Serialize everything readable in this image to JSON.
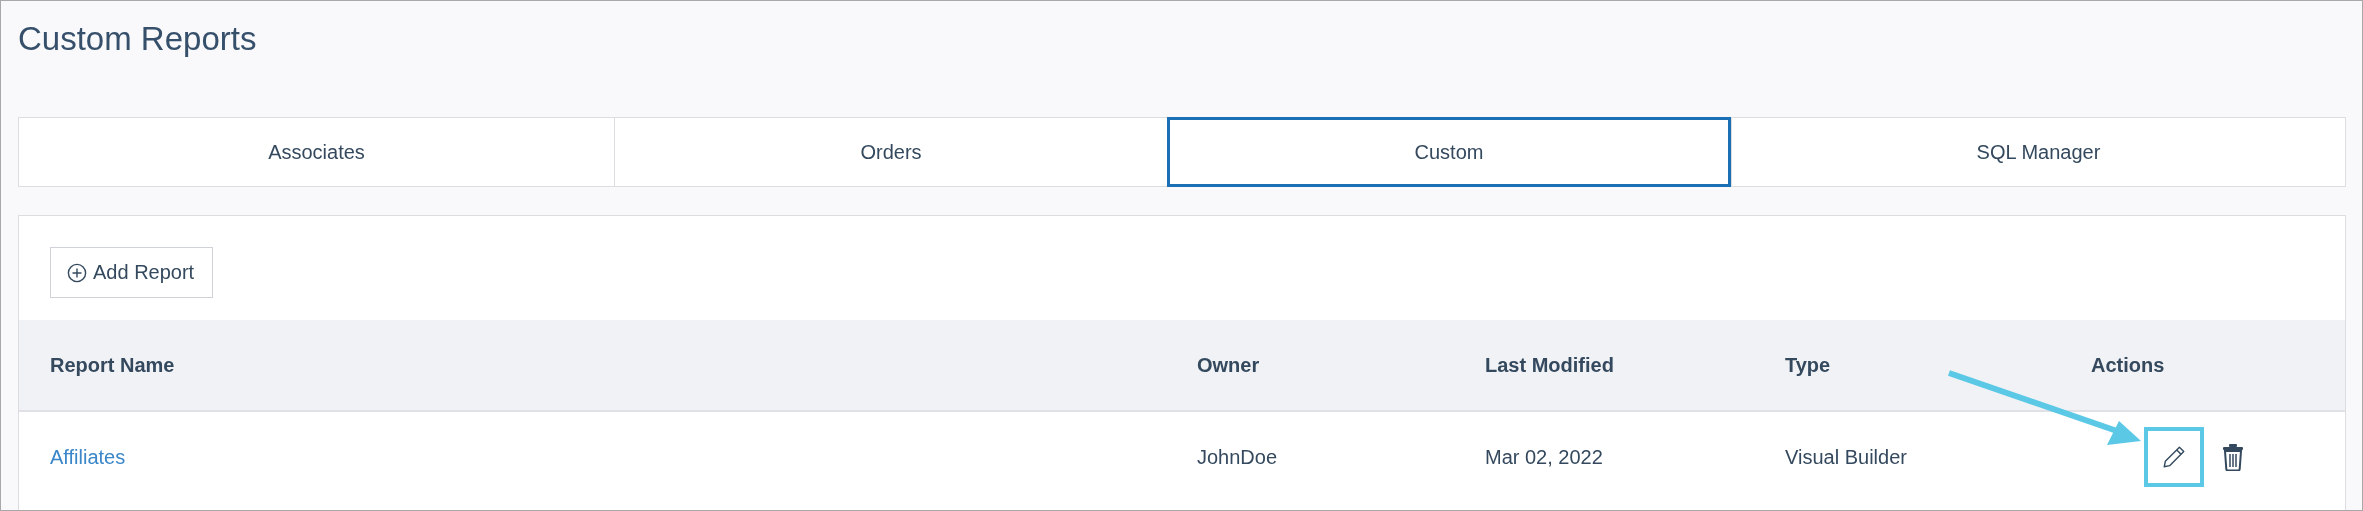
{
  "page": {
    "title": "Custom Reports"
  },
  "tabs": [
    {
      "label": "Associates",
      "selected": false
    },
    {
      "label": "Orders",
      "selected": false
    },
    {
      "label": "Custom",
      "selected": true
    },
    {
      "label": "SQL Manager",
      "selected": false
    }
  ],
  "toolbar": {
    "add_button": "Add Report"
  },
  "table": {
    "columns": [
      "Report Name",
      "Owner",
      "Last Modified",
      "Type",
      "Actions"
    ],
    "rows": [
      {
        "report_name": "Affiliates",
        "owner": "JohnDoe",
        "last_modified": "Mar 02, 2022",
        "type": "Visual Builder",
        "edit_highlighted": true
      }
    ]
  }
}
